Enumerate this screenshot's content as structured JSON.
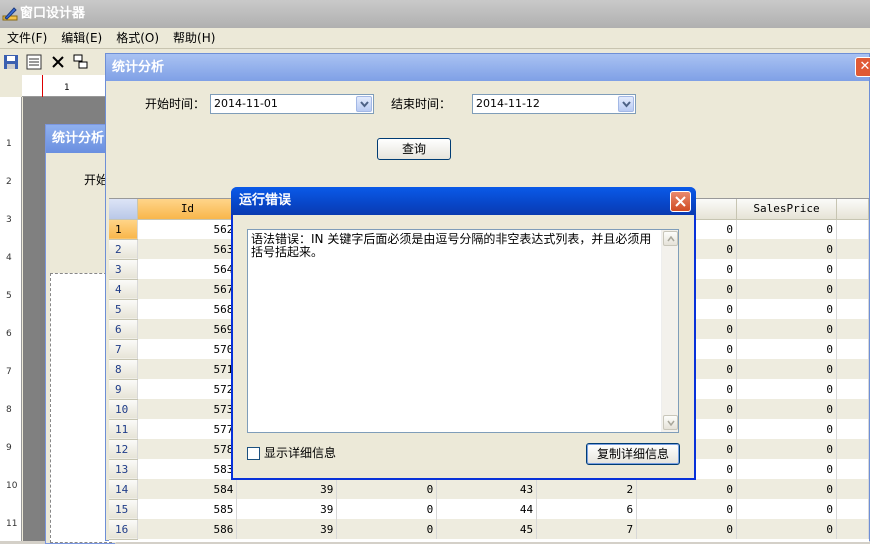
{
  "designer": {
    "title": "窗口设计器",
    "menu": [
      "文件(F)",
      "编辑(E)",
      "格式(O)",
      "帮助(H)"
    ],
    "ruler_top_label": "1",
    "ruler_left_labels": [
      "1",
      "2",
      "3",
      "4",
      "5",
      "6",
      "7",
      "8",
      "9",
      "10",
      "11"
    ],
    "inner_form_title": "统计分析",
    "inner_form_label": "开始"
  },
  "stats": {
    "title": "统计分析",
    "start_label": "开始时间：",
    "start_value": "2014-11-01",
    "end_label": "结束时间：",
    "end_value": "2014-11-12",
    "query_label": "查询",
    "columns": [
      "Id",
      "",
      "",
      "",
      "",
      "",
      "SalesPrice"
    ],
    "rows": [
      {
        "n": "1",
        "cells": [
          "562",
          "",
          "",
          "",
          "",
          "0",
          "0"
        ]
      },
      {
        "n": "2",
        "cells": [
          "563",
          "",
          "",
          "",
          "",
          "0",
          "0"
        ]
      },
      {
        "n": "3",
        "cells": [
          "564",
          "",
          "",
          "",
          "",
          "0",
          "0"
        ]
      },
      {
        "n": "4",
        "cells": [
          "567",
          "",
          "",
          "",
          "",
          "0",
          "0"
        ]
      },
      {
        "n": "5",
        "cells": [
          "568",
          "",
          "",
          "",
          "",
          "0",
          "0"
        ]
      },
      {
        "n": "6",
        "cells": [
          "569",
          "",
          "",
          "",
          "",
          "0",
          "0"
        ]
      },
      {
        "n": "7",
        "cells": [
          "570",
          "",
          "",
          "",
          "",
          "0",
          "0"
        ]
      },
      {
        "n": "8",
        "cells": [
          "571",
          "",
          "",
          "",
          "",
          "0",
          "0"
        ]
      },
      {
        "n": "9",
        "cells": [
          "572",
          "",
          "",
          "",
          "",
          "0",
          "0"
        ]
      },
      {
        "n": "10",
        "cells": [
          "573",
          "",
          "",
          "",
          "",
          "0",
          "0"
        ]
      },
      {
        "n": "11",
        "cells": [
          "577",
          "",
          "",
          "",
          "",
          "0",
          "0"
        ]
      },
      {
        "n": "12",
        "cells": [
          "578",
          "",
          "",
          "",
          "",
          "0",
          "0"
        ]
      },
      {
        "n": "13",
        "cells": [
          "583",
          "",
          "",
          "",
          "",
          "0",
          "0"
        ]
      },
      {
        "n": "14",
        "cells": [
          "584",
          "39",
          "0",
          "43",
          "2",
          "0",
          "0"
        ]
      },
      {
        "n": "15",
        "cells": [
          "585",
          "39",
          "0",
          "44",
          "6",
          "0",
          "0"
        ]
      },
      {
        "n": "16",
        "cells": [
          "586",
          "39",
          "0",
          "45",
          "7",
          "0",
          "0"
        ]
      }
    ]
  },
  "error_dialog": {
    "title": "运行错误",
    "message": "语法错误：IN 关键字后面必须是由逗号分隔的非空表达式列表，并且必须用括号括起来。",
    "show_details_label": "显示详细信息",
    "show_details_checked": false,
    "copy_label": "复制详细信息"
  }
}
